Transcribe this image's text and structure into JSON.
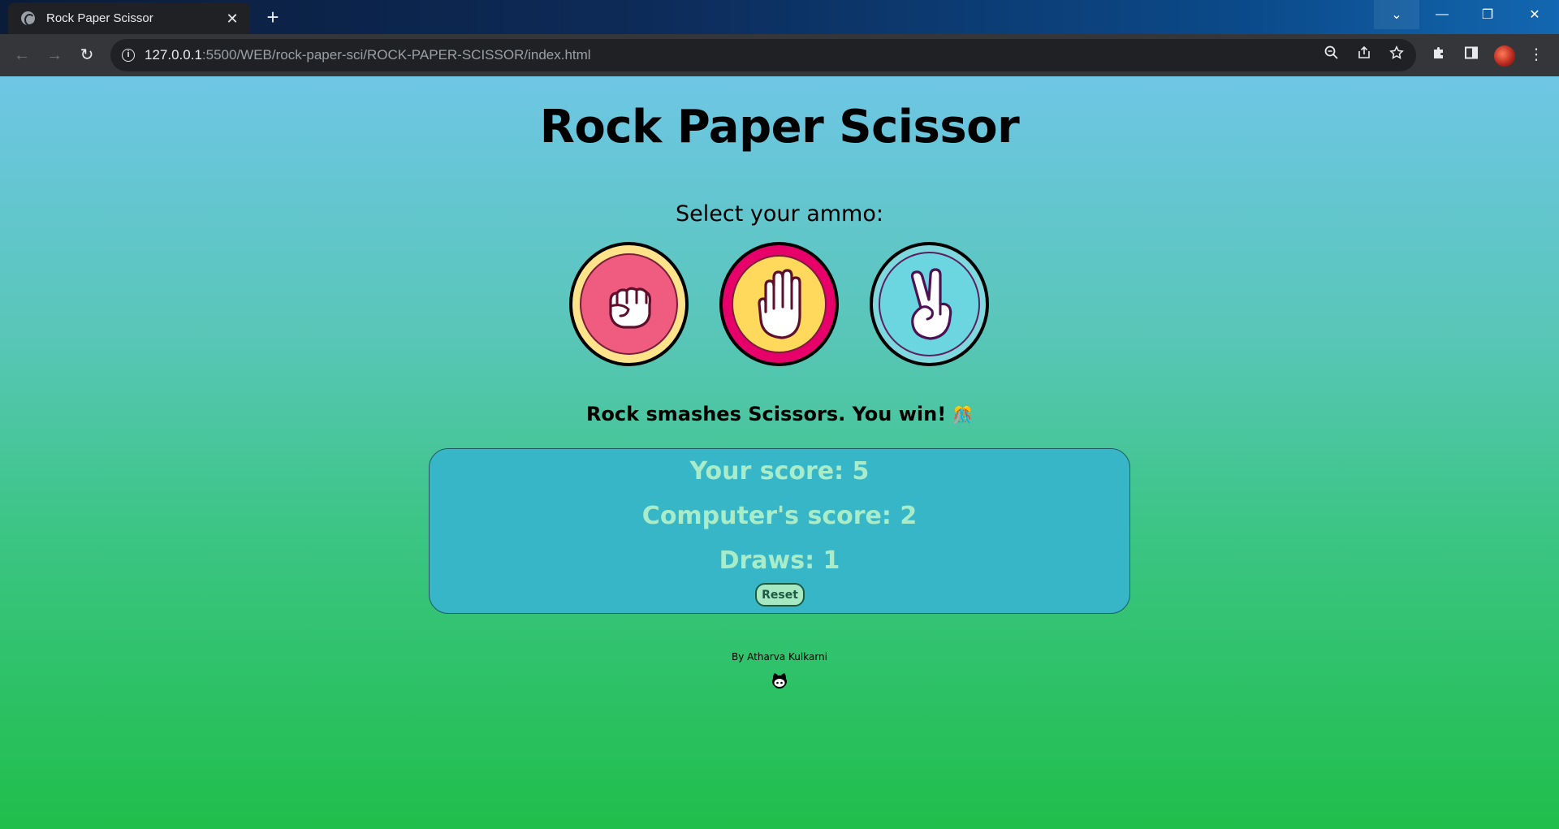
{
  "browser": {
    "tab_title": "Rock Paper Scissor",
    "tab_close": "✕",
    "new_tab": "+",
    "url_host": "127.0.0.1",
    "url_rest": ":5500/WEB/rock-paper-sci/ROCK-PAPER-SCISSOR/index.html",
    "window_controls": {
      "dropdown": "⌄",
      "minimize": "—",
      "maximize": "❐",
      "close": "✕"
    },
    "nav": {
      "back": "←",
      "forward": "→",
      "reload": "↻"
    },
    "toolbar_icons": [
      "zoom-icon",
      "share-icon",
      "bookmark-star-icon",
      "extensions-icon",
      "side-panel-icon",
      "profile-avatar",
      "menu-kebab-icon"
    ]
  },
  "page": {
    "title": "Rock Paper Scissor",
    "ammo_label": "Select your ammo:",
    "choices": [
      {
        "name": "rock",
        "icon": "rock-fist-icon",
        "outer_color": "#ffe38a",
        "inner_color": "#ef5c7f"
      },
      {
        "name": "paper",
        "icon": "paper-hand-icon",
        "outer_color": "#e8006a",
        "inner_color": "#ffd95c"
      },
      {
        "name": "scissor",
        "icon": "scissor-hand-icon",
        "outer_color": "#7ed8dd",
        "inner_color": "#6bd6df"
      }
    ],
    "result_text": "Rock smashes Scissors. You win!",
    "result_emoji": "🎊",
    "scores": {
      "your": "Your score: 5",
      "computer": "Computer's score: 2",
      "draws": "Draws: 1"
    },
    "reset_label": "Reset",
    "byline": "By Atharva Kulkarni",
    "footer_icon": "github-icon"
  }
}
